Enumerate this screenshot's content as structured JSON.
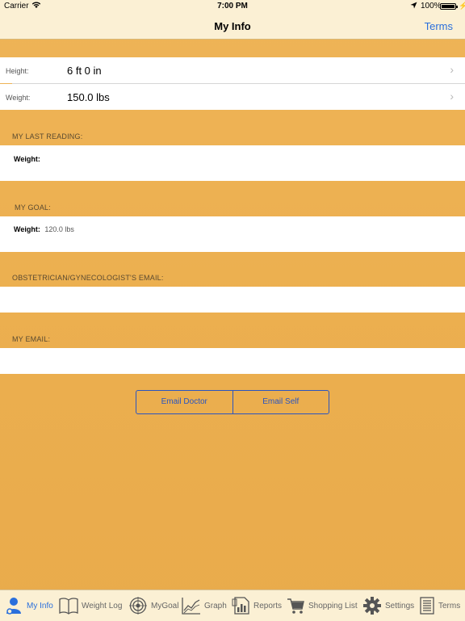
{
  "status": {
    "carrier": "Carrier",
    "time": "7:00 PM",
    "battery": "100%"
  },
  "nav": {
    "title": "My Info",
    "terms_label": "Terms"
  },
  "profile": {
    "height_label": "Height:",
    "height_value": "6 ft 0 in",
    "weight_label": "Weight:",
    "weight_value": "150.0 lbs"
  },
  "last_reading": {
    "header": "MY LAST READING:",
    "weight_label": "Weight:",
    "weight_value": ""
  },
  "goal": {
    "header": "MY GOAL:",
    "weight_label": "Weight:",
    "weight_value": "120.0 lbs"
  },
  "doctor_email": {
    "header": "OBSTETRICIAN/GYNECOLOGIST'S EMAIL:",
    "value": ""
  },
  "my_email": {
    "header": "MY EMAIL:",
    "value": ""
  },
  "actions": {
    "email_doctor": "Email Doctor",
    "email_self": "Email Self"
  },
  "colors": {
    "accent": "#2a6fdc",
    "background": "#ebae4e",
    "bar": "#fbf0d4"
  },
  "tabs": [
    {
      "label": "My Info",
      "icon": "person-icon",
      "active": true
    },
    {
      "label": "Weight Log",
      "icon": "book-icon",
      "active": false
    },
    {
      "label": "MyGoal",
      "icon": "target-icon",
      "active": false
    },
    {
      "label": "Graph",
      "icon": "graph-icon",
      "active": false
    },
    {
      "label": "Reports",
      "icon": "reports-icon",
      "active": false
    },
    {
      "label": "Shopping List",
      "icon": "cart-icon",
      "active": false
    },
    {
      "label": "Settings",
      "icon": "gear-icon",
      "active": false
    },
    {
      "label": "Terms",
      "icon": "document-icon",
      "active": false
    }
  ]
}
